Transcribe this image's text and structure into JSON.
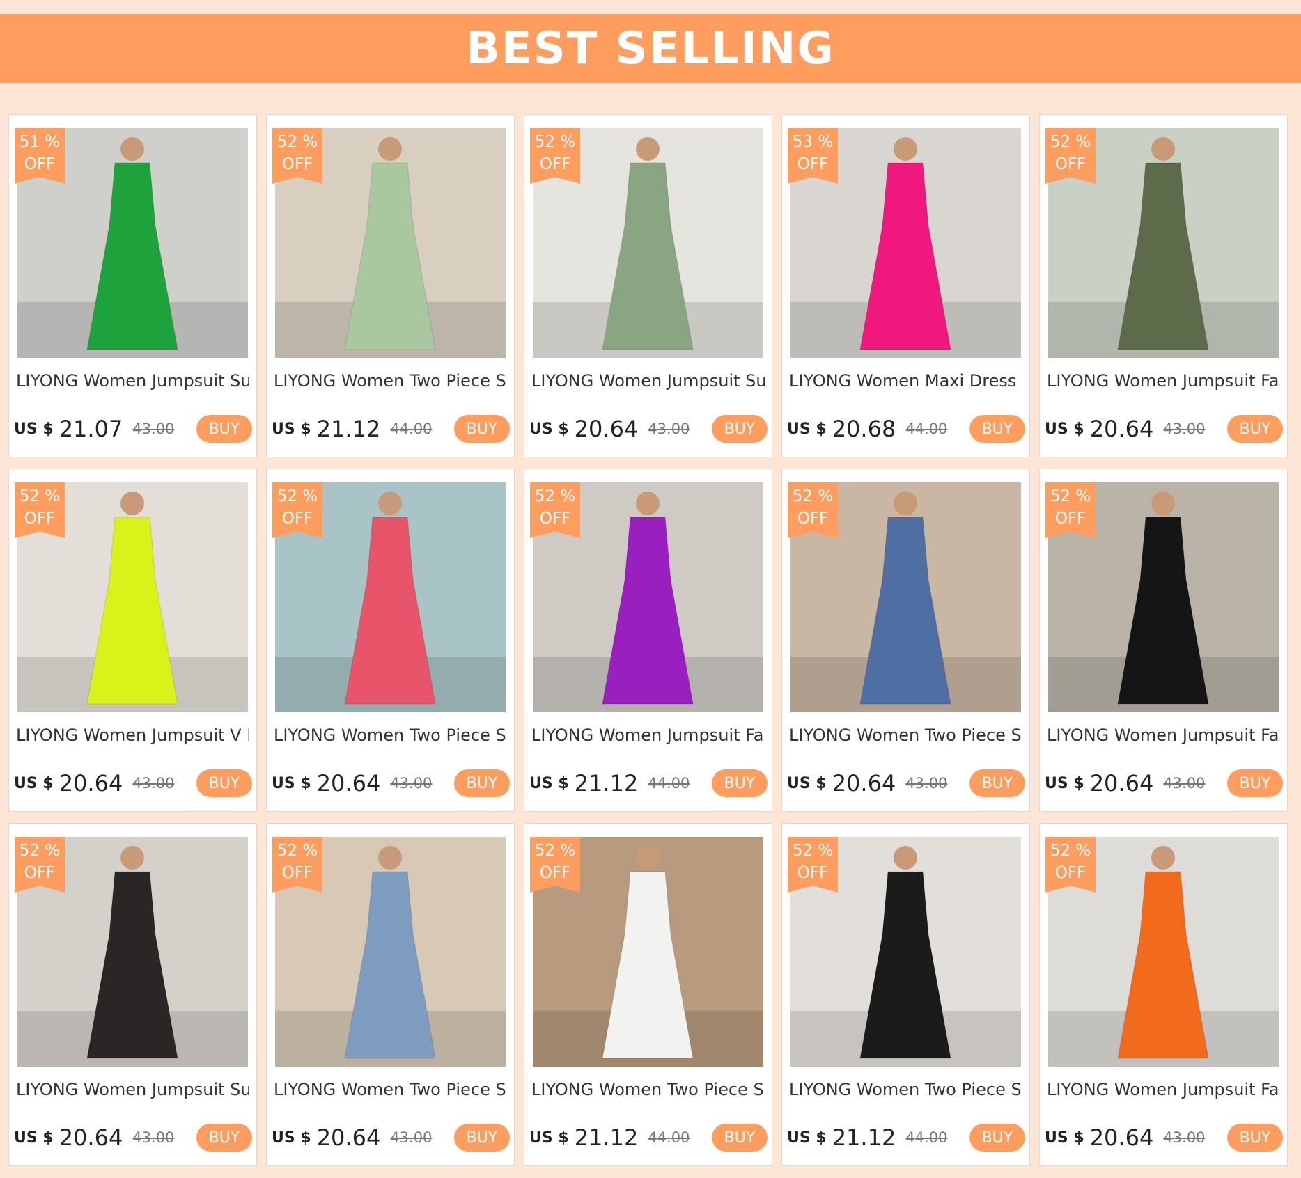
{
  "header": {
    "title": "BEST SELLING"
  },
  "colors": {
    "accent": "#fe9d5e",
    "page_bg": "#fde6d6"
  },
  "products": [
    {
      "discount": "51 %",
      "off": "OFF",
      "title": "LIYONG  Women Jumpsuit Summer Fashion V Neck",
      "currency": "US $",
      "price": "21.07",
      "original": "43.00",
      "buy": "BUY",
      "garment": "#1ea33c",
      "bg": "#cfd0cc"
    },
    {
      "discount": "52 %",
      "off": "OFF",
      "title": "LIYONG  Women Two Piece Set Summer Fashion Crop",
      "currency": "US $",
      "price": "21.12",
      "original": "44.00",
      "buy": "BUY",
      "garment": "#a9c8a0",
      "bg": "#d8cfc0"
    },
    {
      "discount": "52 %",
      "off": "OFF",
      "title": "LIYONG  Women Jumpsuit Summer Fashion Round",
      "currency": "US $",
      "price": "20.64",
      "original": "43.00",
      "buy": "BUY",
      "garment": "#8aa582",
      "bg": "#e6e4df"
    },
    {
      "discount": "53 %",
      "off": "OFF",
      "title": "LIYONG  Women Maxi Dress Fashion Elegant Long Sleeve",
      "currency": "US $",
      "price": "20.68",
      "original": "44.00",
      "buy": "BUY",
      "garment": "#f0187e",
      "bg": "#d9d6d1"
    },
    {
      "discount": "52 %",
      "off": "OFF",
      "title": "LIYONG  Women Jumpsuit Fashion V Neck High Waist",
      "currency": "US $",
      "price": "20.64",
      "original": "43.00",
      "buy": "BUY",
      "garment": "#5e6b4b",
      "bg": "#c9d0c4"
    },
    {
      "discount": "52 %",
      "off": "OFF",
      "title": "LIYONG  Women Jumpsuit V Neck Summer Long Sleeveless",
      "currency": "US $",
      "price": "20.64",
      "original": "43.00",
      "buy": "BUY",
      "garment": "#d9f21a",
      "bg": "#e3dfd8"
    },
    {
      "discount": "52 %",
      "off": "OFF",
      "title": "LIYONG  Women Two Piece Set Fashion Printing Slim",
      "currency": "US $",
      "price": "20.64",
      "original": "43.00",
      "buy": "BUY",
      "garment": "#e8546a",
      "bg": "#a8c4c6"
    },
    {
      "discount": "52 %",
      "off": "OFF",
      "title": "LIYONG  Women Jumpsuit Fashion Round Neck High",
      "currency": "US $",
      "price": "21.12",
      "original": "44.00",
      "buy": "BUY",
      "garment": "#9a1fbf",
      "bg": "#cfcac4"
    },
    {
      "discount": "52 %",
      "off": "OFF",
      "title": "LIYONG  Women Two Piece Set Fashion Solid Short",
      "currency": "US $",
      "price": "20.64",
      "original": "43.00",
      "buy": "BUY",
      "garment": "#4f6ea3",
      "bg": "#c9b6a3"
    },
    {
      "discount": "52 %",
      "off": "OFF",
      "title": "LIYONG  Women Jumpsuit Fashion Sexy Solid",
      "currency": "US $",
      "price": "20.64",
      "original": "43.00",
      "buy": "BUY",
      "garment": "#151515",
      "bg": "#b9b3a8"
    },
    {
      "discount": "52 %",
      "off": "OFF",
      "title": "LIYONG  Women Jumpsuit Summer Fashion Round",
      "currency": "US $",
      "price": "20.64",
      "original": "43.00",
      "buy": "BUY",
      "garment": "#2b2626",
      "bg": "#d4d1cb"
    },
    {
      "discount": "52 %",
      "off": "OFF",
      "title": "LIYONG  Women Two Piece Set Fashion Elegant Solid",
      "currency": "US $",
      "price": "20.64",
      "original": "43.00",
      "buy": "BUY",
      "garment": "#7d9cc0",
      "bg": "#d7c9b6"
    },
    {
      "discount": "52 %",
      "off": "OFF",
      "title": "LIYONG  Women Two Piece Set Summer Casual Solid",
      "currency": "US $",
      "price": "21.12",
      "original": "44.00",
      "buy": "BUY",
      "garment": "#f2f2f0",
      "bg": "#b89a7e"
    },
    {
      "discount": "52 %",
      "off": "OFF",
      "title": "LIYONG  Women Two Piece Set Summer Fashion V Neck",
      "currency": "US $",
      "price": "21.12",
      "original": "44.00",
      "buy": "BUY",
      "garment": "#1b1b1b",
      "bg": "#e2dfdb"
    },
    {
      "discount": "52 %",
      "off": "OFF",
      "title": "LIYONG  Women Jumpsuit Fashion Slim",
      "currency": "US $",
      "price": "20.64",
      "original": "43.00",
      "buy": "BUY",
      "garment": "#f26a1b",
      "bg": "#dedcd8"
    }
  ]
}
